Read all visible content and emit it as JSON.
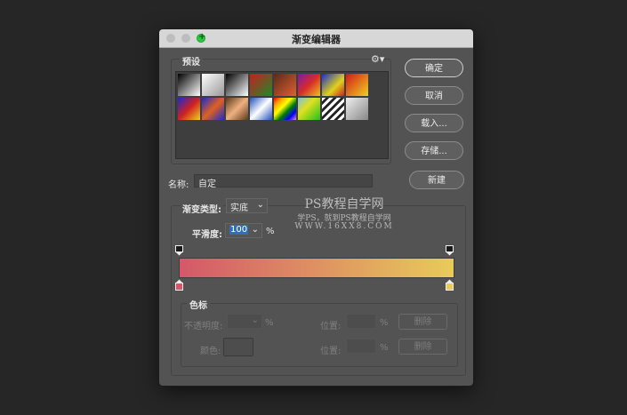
{
  "dialog": {
    "title": "渐变编辑器"
  },
  "presets": {
    "label": "预设",
    "swatches": [
      "linear-gradient(135deg,#000 0%,#fff 100%)",
      "linear-gradient(135deg,#fff 0%,#999 100%)",
      "linear-gradient(135deg,#000 0%,#fff 100%)",
      "linear-gradient(135deg,#c81e1e 0%,#1e8a2a 100%)",
      "linear-gradient(135deg,#5a2a1a 0%,#e06030 100%)",
      "linear-gradient(135deg,#7a1aa8 0%,#d62b2b 50%,#f0c020 100%)",
      "linear-gradient(135deg,#1a2ad0 0%,#e0d21a 60%,#c82020 100%)",
      "linear-gradient(135deg,#d01a1a 0%,#f0d020 100%)",
      "linear-gradient(135deg,#1a2ad0 0%,#d02020 50%,#f0d020 100%)",
      "linear-gradient(135deg,#1a2ad0 0%,#e06020 50%,#1a2ad0 100%)",
      "linear-gradient(135deg,#5a3a1a 0%,#f0b080 50%,#5a3a1a 100%)",
      "linear-gradient(135deg,#2050c0 0%,#ffffff 50%,#2050c0 100%)",
      "linear-gradient(135deg,red,orange,yellow,green,blue,violet)",
      "linear-gradient(135deg,#7ac0e0 0%,#e0e020 40%,#20c020 100%)",
      "repeating-linear-gradient(135deg,#fff 0 3px,#222 3px 6px)",
      "linear-gradient(135deg,#eee 0%,#888 100%)"
    ]
  },
  "buttons": {
    "ok": "确定",
    "cancel": "取消",
    "load": "载入...",
    "save": "存储...",
    "new": "新建"
  },
  "name_field": {
    "label": "名称:",
    "value": "自定"
  },
  "gradient_type": {
    "label": "渐变类型:",
    "value": "实底"
  },
  "smoothness": {
    "label": "平滑度:",
    "value": "100",
    "unit": "%"
  },
  "gradient": {
    "start_color": "#d4586a",
    "end_color": "#e8cb5a"
  },
  "color_stops": {
    "group_label": "色标",
    "opacity_label": "不透明度:",
    "opacity_unit": "%",
    "location_label_1": "位置:",
    "location_unit_1": "%",
    "delete_label_1": "删除",
    "color_label": "颜色:",
    "location_label_2": "位置:",
    "location_unit_2": "%",
    "delete_label_2": "删除"
  },
  "watermark": {
    "line1": "PS教程自学网",
    "line2": "学PS，就到PS教程自学网",
    "line3": "WWW.16XX8.COM"
  }
}
